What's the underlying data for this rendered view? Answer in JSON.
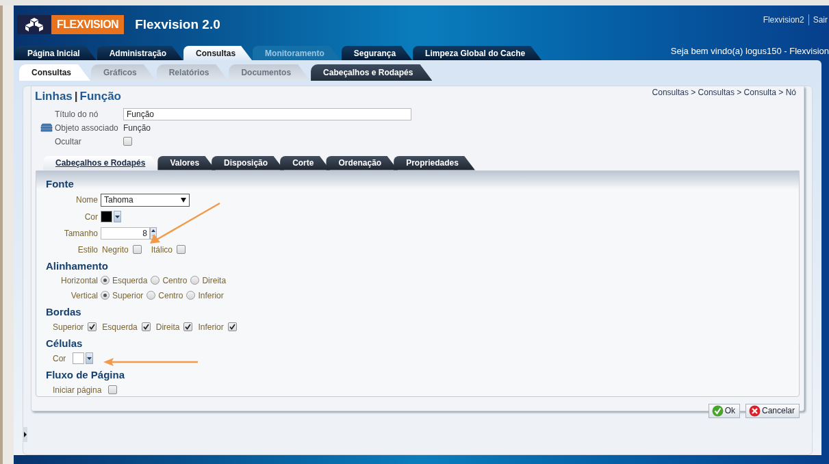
{
  "header": {
    "logo_text": "FLEXVISION",
    "app_title": "Flexvision 2.0",
    "user_links": [
      "Flexvision2",
      "Sair"
    ],
    "welcome": "Seja bem vindo(a) logus150 - Flexvision"
  },
  "main_tabs": [
    {
      "label": "Página Inicial",
      "selected": false,
      "disabled": false
    },
    {
      "label": "Administração",
      "selected": false,
      "disabled": false
    },
    {
      "label": "Consultas",
      "selected": true,
      "disabled": false
    },
    {
      "label": "Monitoramento",
      "selected": false,
      "disabled": true
    },
    {
      "label": "Segurança",
      "selected": false,
      "disabled": false
    },
    {
      "label": "Limpeza Global do Cache",
      "selected": false,
      "disabled": false
    }
  ],
  "sub_tabs": [
    {
      "label": "Consultas",
      "selected": true,
      "dark": false
    },
    {
      "label": "Gráficos",
      "selected": false,
      "dark": false
    },
    {
      "label": "Relatórios",
      "selected": false,
      "dark": false
    },
    {
      "label": "Documentos",
      "selected": false,
      "dark": false
    },
    {
      "label": "Cabeçalhos e Rodapés",
      "selected": false,
      "dark": true
    }
  ],
  "page": {
    "title": "Linhas",
    "separator": "|",
    "subtitle": "Função",
    "breadcrumb": "Consultas > Consultas > Consulta > Nó"
  },
  "node": {
    "title_label": "Título do nó",
    "title_value": "Função",
    "object_label": "Objeto associado",
    "object_value": "Função",
    "hide_label": "Ocultar",
    "hide_checked": false
  },
  "form_tabs": [
    {
      "label": "Cabeçalhos e Rodapés",
      "selected": true
    },
    {
      "label": "Valores",
      "selected": false
    },
    {
      "label": "Disposição",
      "selected": false
    },
    {
      "label": "Corte",
      "selected": false
    },
    {
      "label": "Ordenação",
      "selected": false
    },
    {
      "label": "Propriedades",
      "selected": false
    }
  ],
  "font": {
    "heading": "Fonte",
    "name_label": "Nome",
    "name_value": "Tahoma",
    "color_label": "Cor",
    "color": "#000000",
    "size_label": "Tamanho",
    "size_value": "8",
    "style_label": "Estilo",
    "styles": [
      {
        "label": "Negrito",
        "checked": false
      },
      {
        "label": "Itálico",
        "checked": false
      }
    ]
  },
  "alignment": {
    "heading": "Alinhamento",
    "rows": [
      {
        "label": "Horizontal",
        "options": [
          {
            "label": "Esquerda",
            "selected": true
          },
          {
            "label": "Centro",
            "selected": false
          },
          {
            "label": "Direita",
            "selected": false
          }
        ]
      },
      {
        "label": "Vertical",
        "options": [
          {
            "label": "Superior",
            "selected": true
          },
          {
            "label": "Centro",
            "selected": false
          },
          {
            "label": "Inferior",
            "selected": false
          }
        ]
      }
    ]
  },
  "borders": {
    "heading": "Bordas",
    "items": [
      {
        "label": "Superior",
        "checked": true
      },
      {
        "label": "Esquerda",
        "checked": true
      },
      {
        "label": "Direita",
        "checked": true
      },
      {
        "label": "Inferior",
        "checked": true
      }
    ]
  },
  "cells": {
    "heading": "Células",
    "color_label": "Cor",
    "color": "#ffffff"
  },
  "page_flow": {
    "heading": "Fluxo de Página",
    "start_label": "Iniciar página",
    "start_checked": false
  },
  "buttons": [
    {
      "kind": "ok",
      "label": "Ok"
    },
    {
      "kind": "cancel",
      "label": "Cancelar"
    }
  ]
}
